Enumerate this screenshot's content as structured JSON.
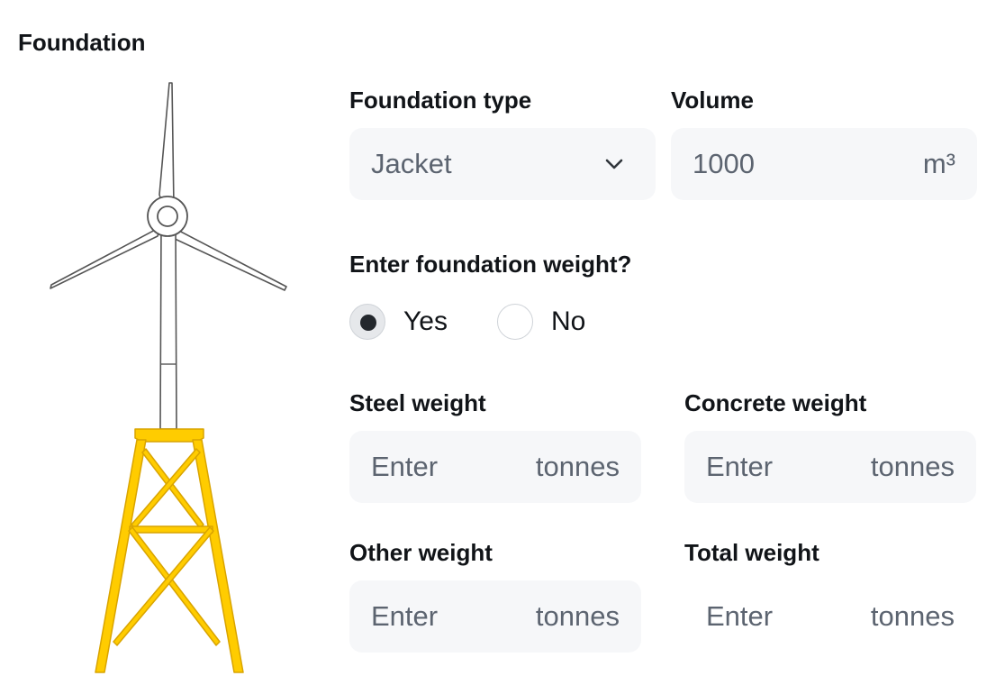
{
  "section": {
    "title": "Foundation"
  },
  "foundation_type": {
    "label": "Foundation type",
    "value": "Jacket"
  },
  "volume": {
    "label": "Volume",
    "value": "1000",
    "unit": "m³"
  },
  "weight_question": {
    "label": "Enter foundation weight?",
    "options": [
      {
        "label": "Yes",
        "selected": true
      },
      {
        "label": "No",
        "selected": false
      }
    ]
  },
  "steel": {
    "label": "Steel weight",
    "placeholder": "Enter",
    "unit": "tonnes"
  },
  "concrete": {
    "label": "Concrete weight",
    "placeholder": "Enter",
    "unit": "tonnes"
  },
  "other": {
    "label": "Other weight",
    "placeholder": "Enter",
    "unit": "tonnes"
  },
  "total": {
    "label": "Total weight",
    "placeholder": "Enter",
    "unit": "tonnes"
  },
  "colors": {
    "jacket_fill": "#ffcc00",
    "jacket_stroke": "#d9a400",
    "field_bg": "#f6f7f9"
  },
  "icons": {
    "turbine": "wind-turbine-icon",
    "dropdown": "chevron-down-icon"
  }
}
